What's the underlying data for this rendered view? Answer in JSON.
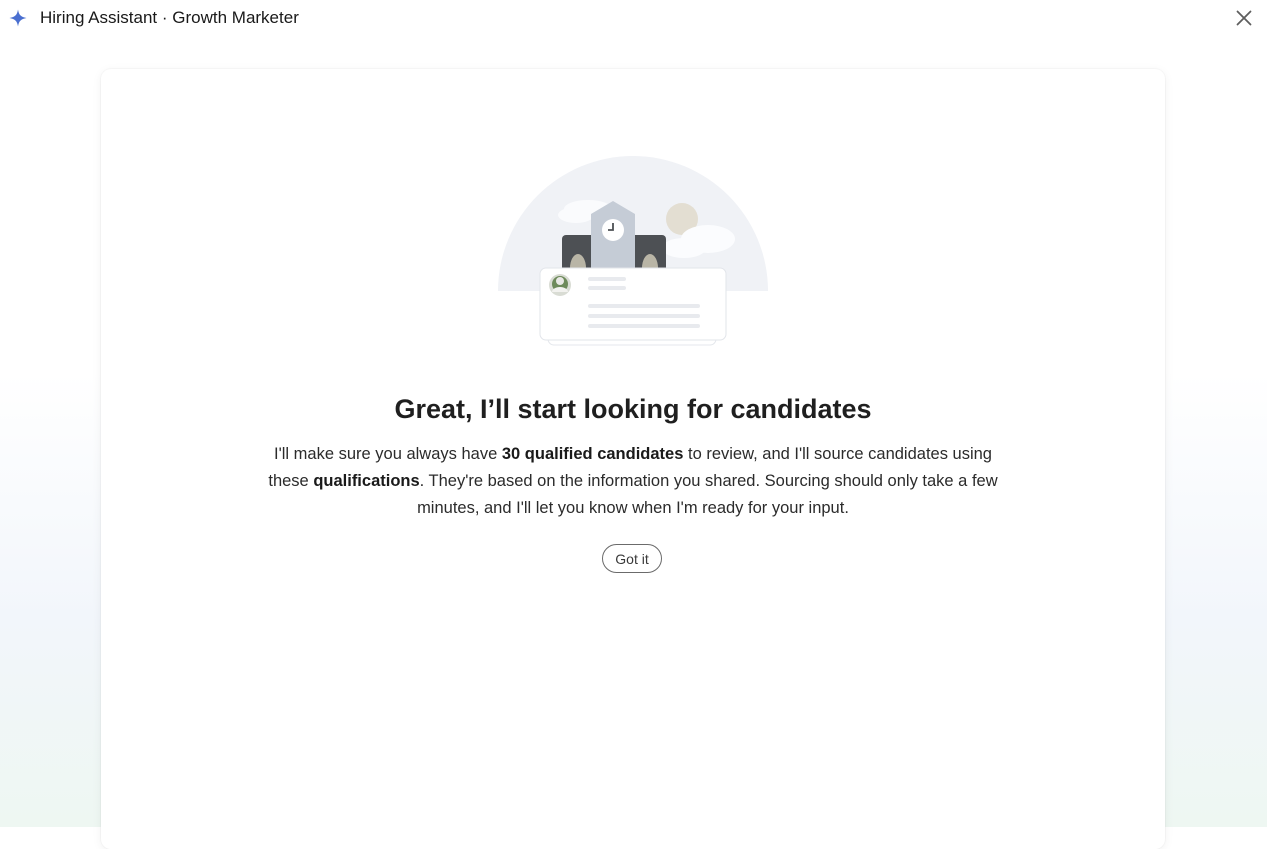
{
  "window": {
    "title": "Hiring Assistant · Growth Marketer",
    "app_icon": "sparkle-icon",
    "close_icon": "close-icon"
  },
  "colors": {
    "accent": "#4a6fd0",
    "card_background": "#ffffff",
    "button_border": "#6b6b6b"
  },
  "main": {
    "illustration": "office-building-candidate-card-illustration",
    "headline": "Great, I’ll start looking for candidates",
    "body": {
      "part1": "I'll make sure you always have ",
      "bold1": "30 qualified candidates",
      "part2": " to review, and I'll source candidates using these ",
      "bold2": "qualifications",
      "part3": ". They're based on the information you shared. Sourcing should only take a few minutes, and I'll let you know when I'm ready for your input."
    },
    "button_label": "Got it"
  }
}
